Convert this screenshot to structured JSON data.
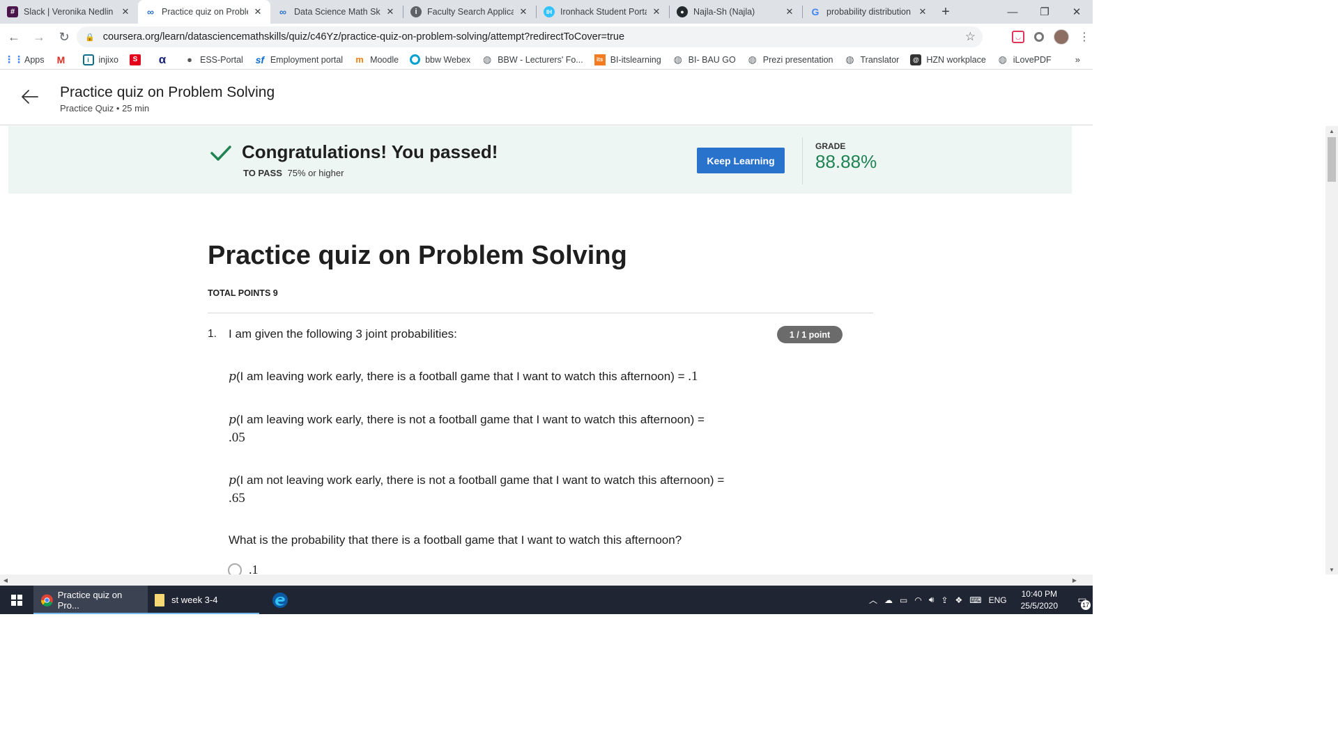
{
  "tabs": [
    {
      "title": "Slack | Veronika Nedlin",
      "icon": "slack-icon",
      "active": false
    },
    {
      "title": "Practice quiz on Proble",
      "icon": "coursera-icon",
      "active": true
    },
    {
      "title": "Data Science Math Skil",
      "icon": "coursera-icon",
      "active": false
    },
    {
      "title": "Faculty Search Applicat",
      "icon": "info-icon",
      "active": false
    },
    {
      "title": "Ironhack Student Porta",
      "icon": "ironhack-icon",
      "active": false
    },
    {
      "title": "Najla-Sh (Najla)",
      "icon": "github-icon",
      "active": false
    },
    {
      "title": "probability distribution",
      "icon": "google-icon",
      "active": false
    }
  ],
  "url": "coursera.org/learn/datasciencemathskills/quiz/c46Yz/practice-quiz-on-problem-solving/attempt?redirectToCover=true",
  "bookmarks": [
    {
      "label": "Apps",
      "icon": "apps-grid-icon",
      "color": "#4285f4"
    },
    {
      "label": "",
      "icon": "gmail-icon",
      "color": "#d93025"
    },
    {
      "label": "injixo",
      "icon": "injixo-icon",
      "color": "#0f6e8c"
    },
    {
      "label": "",
      "icon": "sparkasse-icon",
      "color": "#e2001a"
    },
    {
      "label": "",
      "icon": "alpha-icon",
      "color": "#1a237e"
    },
    {
      "label": "ESS-Portal",
      "icon": "apple-icon",
      "color": "#555555"
    },
    {
      "label": "Employment portal",
      "icon": "sf-icon",
      "color": "#0a6ed1"
    },
    {
      "label": "Moodle",
      "icon": "moodle-icon",
      "color": "#f98012"
    },
    {
      "label": "bbw Webex",
      "icon": "webex-icon",
      "color": "#00a0d1"
    },
    {
      "label": "BBW - Lecturers' Fo...",
      "icon": "globe-icon",
      "color": "#5f6368"
    },
    {
      "label": "BI-itslearning",
      "icon": "its-icon",
      "color": "#f47b20"
    },
    {
      "label": "BI- BAU GO",
      "icon": "globe-icon",
      "color": "#5f6368"
    },
    {
      "label": "Prezi presentation",
      "icon": "globe-icon",
      "color": "#5f6368"
    },
    {
      "label": "Translator",
      "icon": "globe-icon",
      "color": "#5f6368"
    },
    {
      "label": "HZN workplace",
      "icon": "hzn-icon",
      "color": "#333333"
    },
    {
      "label": "iLovePDF",
      "icon": "globe-icon",
      "color": "#5f6368"
    }
  ],
  "bookmarks_more": "»",
  "header": {
    "title": "Practice quiz on Problem Solving",
    "subtitle": "Practice Quiz • 25 min"
  },
  "banner": {
    "message": "Congratulations! You passed!",
    "to_pass_label": "TO PASS",
    "to_pass_value": "75% or higher",
    "button_label": "Keep Learning",
    "grade_label": "GRADE",
    "grade_value": "88.88%"
  },
  "quiz": {
    "title": "Practice quiz on Problem Solving",
    "total_points": "TOTAL POINTS 9",
    "question_number": "1.",
    "question_intro": "I am given the following 3 joint probabilities:",
    "points_badge": "1 / 1 point",
    "p_symbol": "p",
    "probabilities": [
      {
        "text": "(I am leaving work early, there is a football game that I want to watch this afternoon) = ",
        "value": ".1"
      },
      {
        "text": "(I am leaving work early, there is not a football game that I want to watch this afternoon) = ",
        "value": ".05"
      },
      {
        "text": "(I am not leaving work early, there is not a football game that I want to watch this afternoon) = ",
        "value": ".65"
      }
    ],
    "question_prompt": "What is the probability that there is a football game that I want to watch this afternoon?",
    "options": [
      ".1"
    ]
  },
  "taskbar": {
    "apps": [
      {
        "label": "Practice quiz on Pro...",
        "icon": "chrome-icon",
        "active": true
      },
      {
        "label": "st week 3-4",
        "icon": "folder-icon",
        "active": false
      },
      {
        "label": "",
        "icon": "edge-icon",
        "active": false
      }
    ],
    "language": "ENG",
    "time": "10:40 PM",
    "date": "25/5/2020",
    "notifications": "17"
  },
  "colors": {
    "accent_blue": "#2a73cc",
    "pass_green": "#1f8354",
    "banner_bg": "#eef6f3"
  }
}
